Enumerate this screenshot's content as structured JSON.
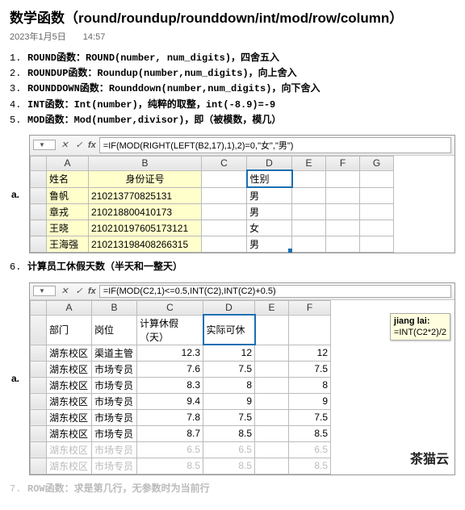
{
  "title": "数学函数（round/roundup/rounddown/int/mod/row/column）",
  "date": "2023年1月5日",
  "time": "14:57",
  "functions": [
    {
      "n": "1.",
      "label": "ROUND函数：",
      "desc": "ROUND(number, num_digits)，四舍五入"
    },
    {
      "n": "2.",
      "label": "ROUNDUP函数：",
      "desc": "Roundup(number,num_digits)，向上舍入"
    },
    {
      "n": "3.",
      "label": "ROUNDDOWN函数：",
      "desc": "Rounddown(number,num_digits)，向下舍入"
    },
    {
      "n": "4.",
      "label": "INT函数：",
      "desc": "Int(number)，纯粹的取整，int(-8.9)=-9"
    },
    {
      "n": "5.",
      "label": "MOD函数：",
      "desc": "Mod(number,divisor)，即（被模数，模几）"
    }
  ],
  "sheet1": {
    "toolbar_cell": "",
    "formula": "=IF(MOD(RIGHT(LEFT(B2,17),1),2)=0,\"女\",\"男\")",
    "cols": [
      "",
      "A",
      "B",
      "C",
      "D",
      "E",
      "F",
      "G"
    ],
    "h1": "姓名",
    "h2": "身份证号",
    "h3": "性别",
    "rows": [
      {
        "a": "鲁帆",
        "b": "210213770825131",
        "d": "男"
      },
      {
        "a": "章戎",
        "b": "210218800410173",
        "d": "男"
      },
      {
        "a": "王晓",
        "b": "210210197605173121",
        "d": "女"
      },
      {
        "a": "王海强",
        "b": "210213198408266315",
        "d": "男"
      }
    ]
  },
  "item6": {
    "n": "6.",
    "text": "计算员工休假天数（半天和一整天）"
  },
  "sheet2": {
    "toolbar_cell": "",
    "formula": "=IF(MOD(C2,1)<=0.5,INT(C2),INT(C2)+0.5)",
    "cols": [
      "",
      "A",
      "B",
      "C",
      "D",
      "E",
      "F"
    ],
    "h_a": "部门",
    "h_b": "岗位",
    "h_c": "计算休假（天）",
    "h_d": "实际可休",
    "note_title": "jiang lai:",
    "note_body": "=INT(C2*2)/2",
    "rows": [
      {
        "a": "湖东校区",
        "b": "渠道主管",
        "c": "12.3",
        "d": "12",
        "f": "12"
      },
      {
        "a": "湖东校区",
        "b": "市场专员",
        "c": "7.6",
        "d": "7.5",
        "f": "7.5"
      },
      {
        "a": "湖东校区",
        "b": "市场专员",
        "c": "8.3",
        "d": "8",
        "f": "8"
      },
      {
        "a": "湖东校区",
        "b": "市场专员",
        "c": "9.4",
        "d": "9",
        "f": "9"
      },
      {
        "a": "湖东校区",
        "b": "市场专员",
        "c": "7.8",
        "d": "7.5",
        "f": "7.5"
      },
      {
        "a": "湖东校区",
        "b": "市场专员",
        "c": "8.7",
        "d": "8.5",
        "f": "8.5"
      }
    ],
    "faded_rows": [
      {
        "a": "湖东校区",
        "b": "市场专员",
        "c": "6.5",
        "d": "6.5",
        "f": "6.5"
      },
      {
        "a": "湖东校区",
        "b": "市场专员",
        "c": "8.5",
        "d": "8.5",
        "f": "8.5"
      }
    ]
  },
  "item7": {
    "n": "7.",
    "text": "ROW函数：求是第几行，无参数时为当前行"
  },
  "watermark": "茶猫云"
}
